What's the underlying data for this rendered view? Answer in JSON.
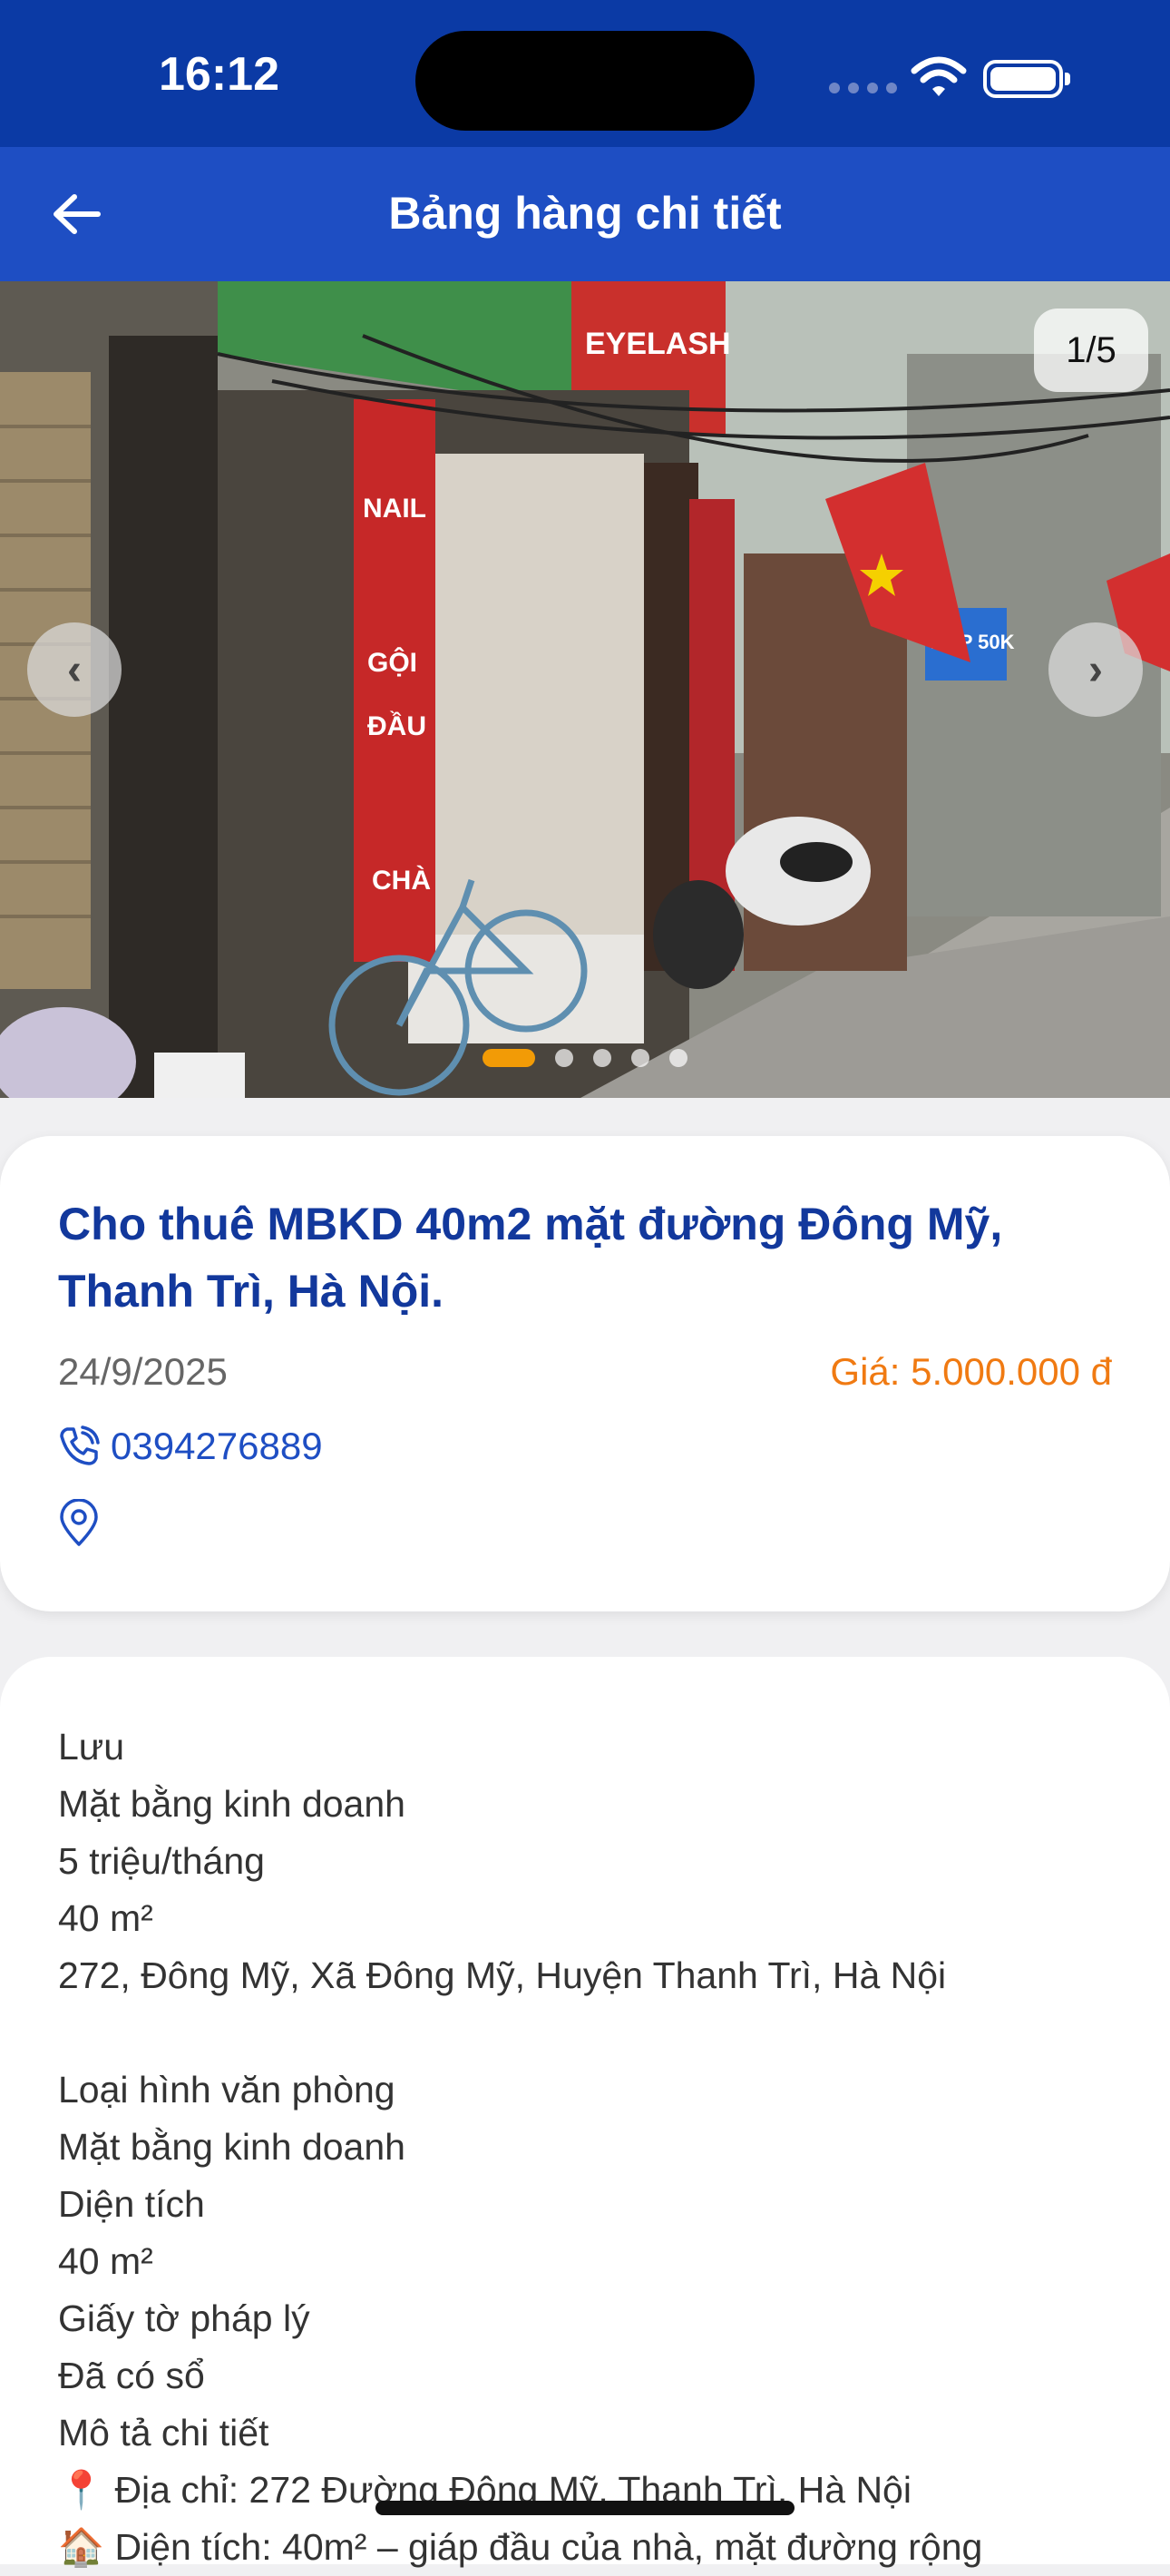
{
  "status_bar": {
    "time": "16:12"
  },
  "app_bar": {
    "title": "Bảng hàng chi tiết"
  },
  "gallery": {
    "counter": "1/5",
    "current_image": 1,
    "total_images": 5,
    "prev_symbol": "‹",
    "next_symbol": "›"
  },
  "listing": {
    "title": "Cho thuê MBKD 40m2 mặt đường Đông Mỹ, Thanh Trì, Hà Nội.",
    "date": "24/9/2025",
    "price": "Giá: 5.000.000 đ",
    "phone": "0394276889"
  },
  "description": {
    "lines": [
      "Lưu",
      "Mặt bằng kinh doanh",
      "5 triệu/tháng",
      "40 m²",
      "272, Đông Mỹ, Xã Đông Mỹ, Huyện Thanh Trì, Hà Nội",
      "",
      "Loại hình văn phòng",
      "Mặt bằng kinh doanh",
      "Diện tích",
      "40 m²",
      "Giấy tờ pháp lý",
      "Đã có sổ",
      "Mô tả chi tiết",
      "📍 Địa chỉ: 272 Đường Đông Mỹ, Thanh Trì, Hà Nội",
      "🏠 Diện tích: 40m² – giáp đầu của nhà, mặt đường rộng"
    ]
  },
  "colors": {
    "status_bar": "#0b3aa5",
    "app_bar": "#1e4ec3",
    "title_text": "#12389c",
    "price": "#f07a12",
    "active_dot": "#f29b06"
  }
}
